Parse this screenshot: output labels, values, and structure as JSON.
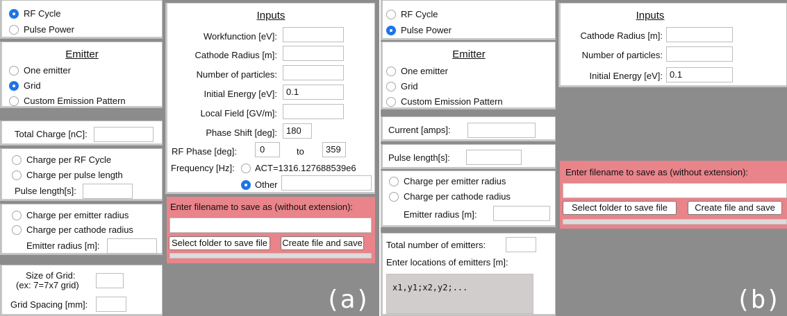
{
  "a": {
    "mode_rf": "RF Cycle",
    "mode_pulse": "Pulse Power",
    "emitter_title": "Emitter",
    "emitter_one": "One emitter",
    "emitter_grid": "Grid",
    "emitter_custom": "Custom Emission Pattern",
    "total_charge_label": "Total Charge [nC]:",
    "charge_rf": "Charge per RF Cycle",
    "charge_pulse": "Charge per pulse length",
    "pulse_length_label": "Pulse length[s]:",
    "charge_emitter_radius": "Charge per emitter radius",
    "charge_cathode_radius": "Charge per cathode radius",
    "emitter_radius_label": "Emitter radius [m]:",
    "grid_size_label1": "Size of Grid:",
    "grid_size_label2": "(ex: 7=7x7 grid)",
    "grid_spacing_label": "Grid Spacing [mm]:",
    "inputs_title": "Inputs",
    "workfunction_label": "Workfunction [eV]:",
    "cathode_radius_label": "Cathode Radius [m]:",
    "num_particles_label": "Number of particles:",
    "initial_energy_label": "Initial Energy [eV]:",
    "initial_energy_value": "0.1",
    "local_field_label": "Local Field [GV/m]:",
    "phase_shift_label": "Phase Shift [deg]:",
    "phase_shift_value": "180",
    "rf_phase_label": "RF Phase [deg]:",
    "rf_phase_from": "0",
    "rf_phase_to_word": "to",
    "rf_phase_to": "359",
    "frequency_label": "Frequency [Hz]:",
    "freq_act": "ACT=1316.127688539e6",
    "freq_other": "Other",
    "filename_prompt": "Enter filename to save as (without extension):",
    "select_folder": "Select folder to save file",
    "create_file": "Create file and save",
    "panel_label": "(a)"
  },
  "b": {
    "mode_rf": "RF Cycle",
    "mode_pulse": "Pulse Power",
    "emitter_title": "Emitter",
    "emitter_one": "One emitter",
    "emitter_grid": "Grid",
    "emitter_custom": "Custom Emission Pattern",
    "current_label": "Current [amps]:",
    "pulse_length_label": "Pulse length[s]:",
    "charge_emitter_radius": "Charge per emitter radius",
    "charge_cathode_radius": "Charge per cathode radius",
    "emitter_radius_label": "Emitter radius [m]:",
    "total_emitters_label": "Total number of emitters:",
    "locations_label": "Enter locations of emitters [m]:",
    "locations_value": "x1,y1;x2,y2;...",
    "inputs_title": "Inputs",
    "cathode_radius_label": "Cathode Radius [m]:",
    "num_particles_label": "Number of particles:",
    "initial_energy_label": "Initial Energy [eV]:",
    "initial_energy_value": "0.1",
    "filename_prompt": "Enter filename to save as (without extension):",
    "select_folder": "Select folder to save file",
    "create_file": "Create file and save",
    "panel_label": "(b)"
  },
  "colors": {
    "accent": "#1e74e8",
    "pink": "#e8848a",
    "gray": "#8c8c8c"
  }
}
